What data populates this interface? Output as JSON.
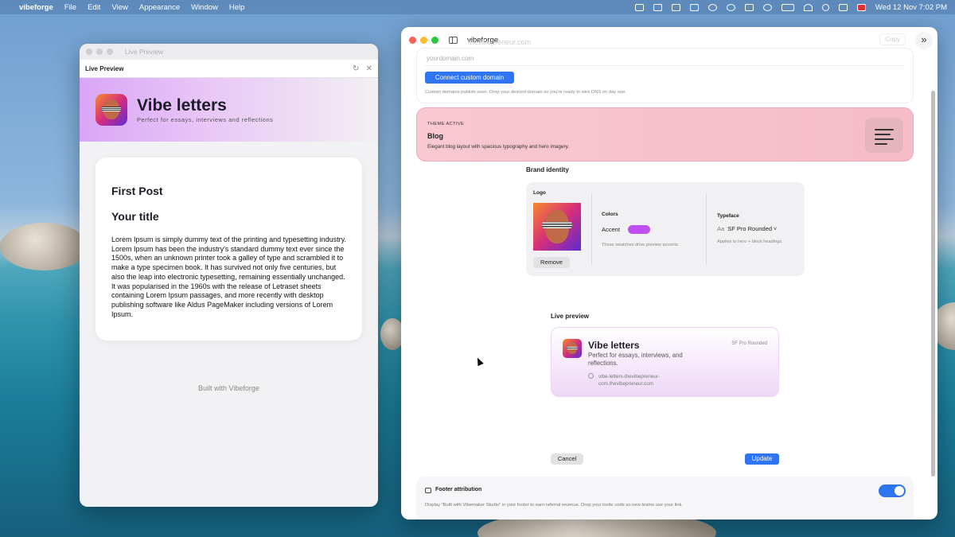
{
  "menubar": {
    "apple": "",
    "app_name": "vibeforge",
    "menus": [
      "File",
      "Edit",
      "View",
      "Appearance",
      "Window",
      "Help"
    ],
    "clock": "Wed 12 Nov  7:02 PM"
  },
  "live_preview_window": {
    "window_title": "Live Preview",
    "toolbar_title": "Live Preview",
    "refresh_icon": "↻",
    "close_icon": "✕",
    "hero_title": "Vibe letters",
    "hero_subtitle": "Perfect for essays, interviews and reflections",
    "post_title": "First Post",
    "post_subtitle": "Your title",
    "post_body": "Lorem Ipsum is simply dummy text of the printing and typesetting industry. Lorem Ipsum has been the industry's standard dummy text ever since the 1500s, when an unknown printer took a galley of type and scrambled it to make a type specimen book. It has survived not only five centuries, but also the leap into electronic typesetting, remaining essentially unchanged. It was popularised in the 1960s with the release of Letraset sheets containing Lorem Ipsum passages, and more recently with desktop publishing software like Aldus PageMaker including versions of Lorem Ipsum.",
    "footer": "Built with Vibeforge"
  },
  "vibeforge_window": {
    "app_name": "vibeforge",
    "ghost_text": "thevibepreneur.com",
    "copy_label": "Copy",
    "expand_icon": "»",
    "domain": {
      "placeholder": "yourdomain.com",
      "connect_button": "Connect custom domain",
      "note": "Custom domains publish soon. Drop your desired domain so you're ready to wire DNS on day one."
    },
    "theme": {
      "kicker": "THEME ACTIVE",
      "name": "Blog",
      "description": "Elegant blog layout with spacious typography and hero imagery."
    },
    "brand": {
      "heading": "Brand identity",
      "logo_label": "Logo",
      "remove_button": "Remove",
      "colors_label": "Colors",
      "accent_label": "Accent",
      "accent_color": "#c04ef0",
      "colors_note": "These swatches drive preview accents.",
      "typeface_label": "Typeface",
      "typeface_prefix": "Aa",
      "typeface_value": "SF Pro Rounded",
      "typeface_note": "Applies to hero + block headings."
    },
    "live_preview": {
      "heading": "Live preview",
      "title": "Vibe letters",
      "subtitle": "Perfect for essays, interviews, and reflections.",
      "font_label": "SF Pro Rounded",
      "url_line1": "vibe-letters-thevibepreneur-",
      "url_line2": "com.thevibepreneur.com"
    },
    "actions": {
      "cancel": "Cancel",
      "update": "Update"
    },
    "footer_attribution": {
      "title": "Footer attribution",
      "description": "Display \"Built with Vibemaker Studio\" in your footer to earn referral revenue. Drop your invite code so new teams use your link.",
      "enabled": true
    }
  }
}
